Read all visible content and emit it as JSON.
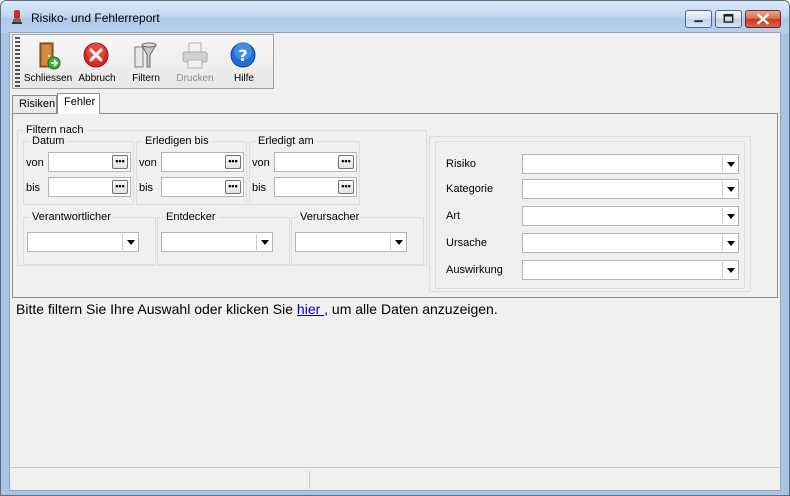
{
  "window": {
    "title": "Risiko- und Fehlerreport"
  },
  "toolbar": {
    "close_label": "Schliessen",
    "abort_label": "Abbruch",
    "filter_label": "Filtern",
    "print_label": "Drucken",
    "help_label": "Hilfe"
  },
  "tabs": [
    {
      "label": "Risiken"
    },
    {
      "label": "Fehler"
    }
  ],
  "filter": {
    "group_title": "Filtern nach",
    "datum": {
      "title": "Datum",
      "from_label": "von",
      "to_label": "bis",
      "from_value": "",
      "to_value": ""
    },
    "erledigen_bis": {
      "title": "Erledigen bis",
      "from_label": "von",
      "to_label": "bis",
      "from_value": "",
      "to_value": ""
    },
    "erledigt_am": {
      "title": "Erledigt am",
      "from_label": "von",
      "to_label": "bis",
      "from_value": "",
      "to_value": ""
    },
    "date_button_label": "•••",
    "verantwortlicher": {
      "title": "Verantwortlicher",
      "value": ""
    },
    "entdecker": {
      "title": "Entdecker",
      "value": ""
    },
    "verursacher": {
      "title": "Verursacher",
      "value": ""
    },
    "right": {
      "risiko": {
        "label": "Risiko",
        "value": ""
      },
      "kategorie": {
        "label": "Kategorie",
        "value": ""
      },
      "art": {
        "label": "Art",
        "value": ""
      },
      "ursache": {
        "label": "Ursache",
        "value": ""
      },
      "auswirkung": {
        "label": "Auswirkung",
        "value": ""
      }
    }
  },
  "message": {
    "before": "Bitte filtern Sie Ihre Auswahl oder klicken Sie ",
    "link": " hier ",
    "after": ", um alle Daten anzuzeigen."
  },
  "colors": {
    "link": "#0000cc",
    "close_button": "#c43a22",
    "help_icon": "#1e6fd9",
    "abort_icon": "#d62b1f"
  }
}
